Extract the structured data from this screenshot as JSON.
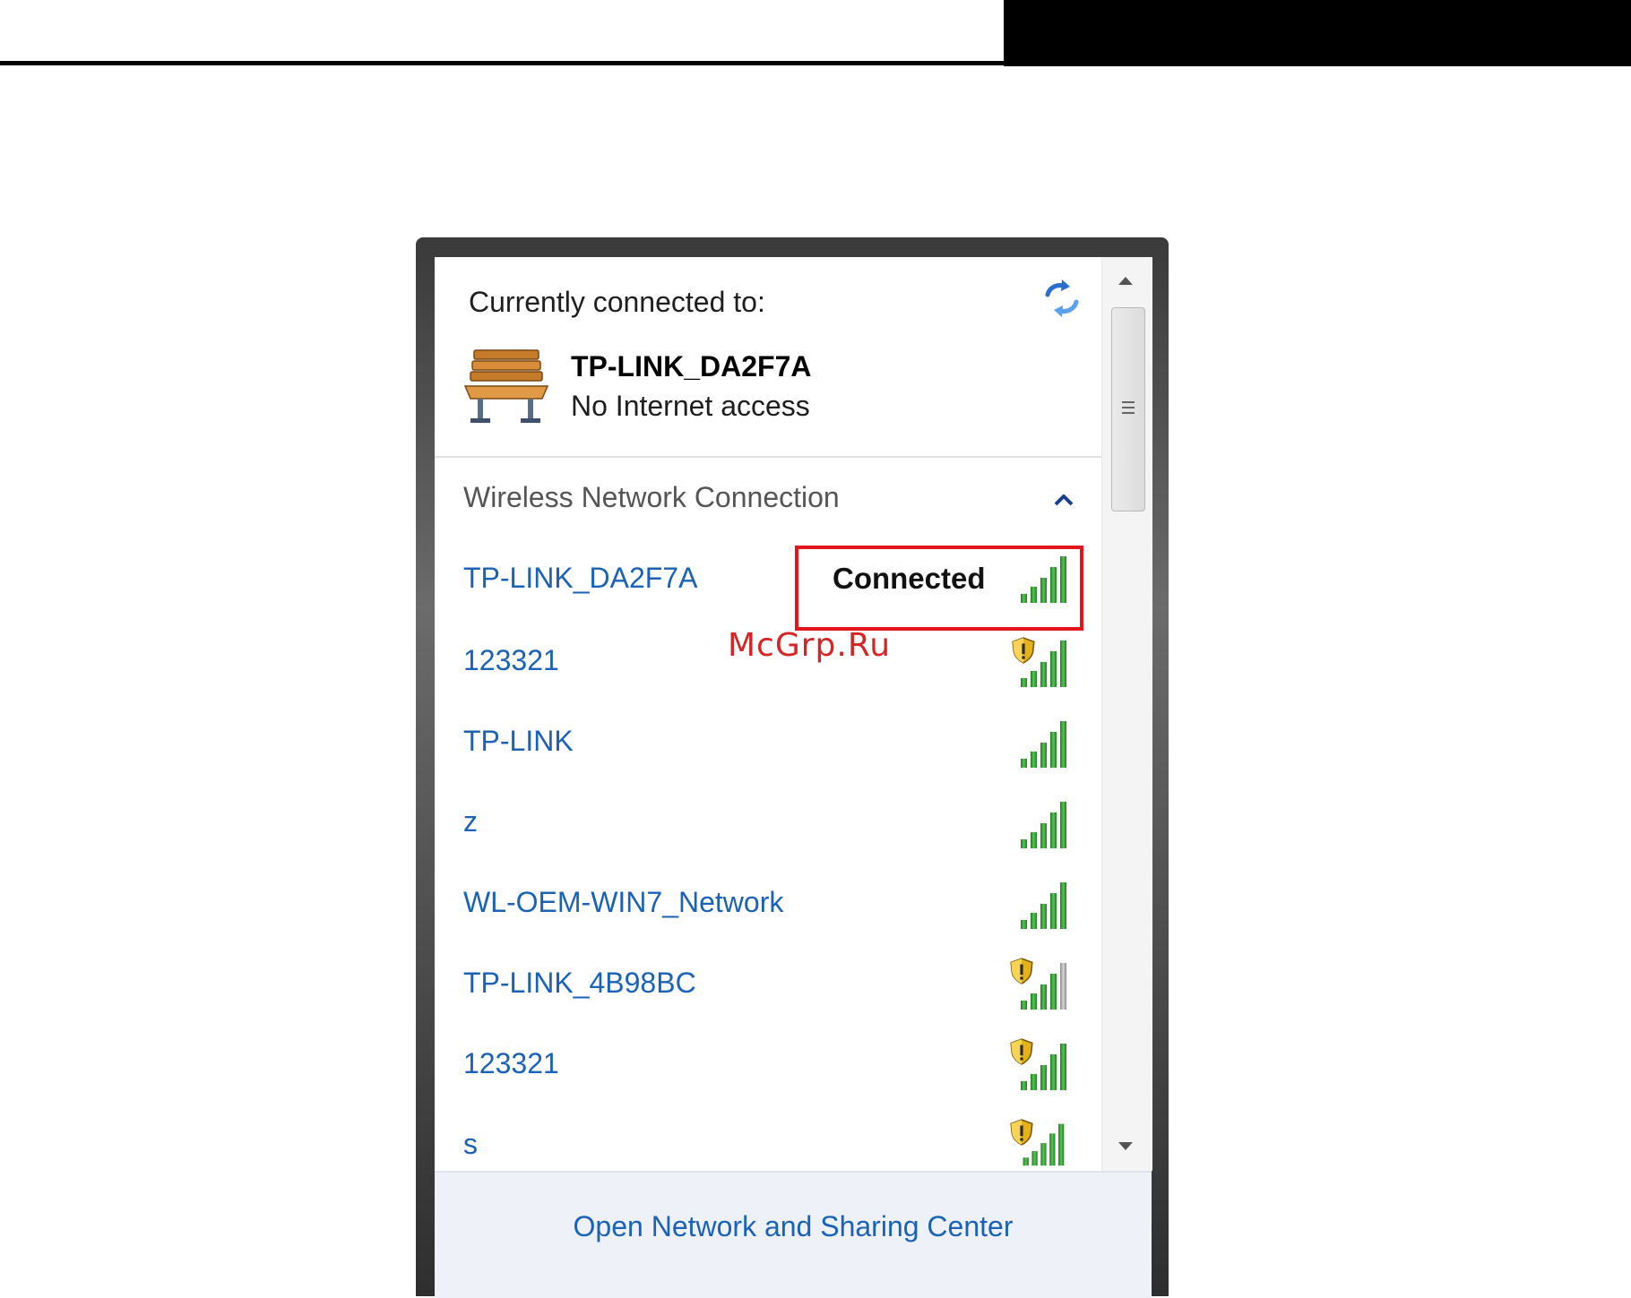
{
  "header": {
    "color": "#000000"
  },
  "flyout": {
    "currently_connected_label": "Currently connected to:",
    "current_network": {
      "name": "TP-LINK_DA2F7A",
      "status": "No Internet access",
      "icon": "bench-network-icon"
    },
    "refresh_icon": "refresh-icon",
    "section_title": "Wireless Network Connection",
    "section_toggle_icon": "chevron-up-icon",
    "networks": [
      {
        "name": "TP-LINK_DA2F7A",
        "status": "Connected",
        "secured": false
      },
      {
        "name": "123321",
        "secured": true
      },
      {
        "name": "TP-LINK",
        "secured": false
      },
      {
        "name": "z",
        "secured": false
      },
      {
        "name": "WL-OEM-WIN7_Network",
        "secured": false
      },
      {
        "name": "TP-LINK_4B98BC",
        "secured": true
      },
      {
        "name": "123321",
        "secured": true
      },
      {
        "name": "s",
        "secured": true
      }
    ],
    "footer_link": "Open Network and Sharing Center",
    "colors": {
      "link": "#1a62b8",
      "signal": "#2e9a2e",
      "highlight": "#e3141c"
    }
  },
  "watermark": "McGrp.Ru"
}
